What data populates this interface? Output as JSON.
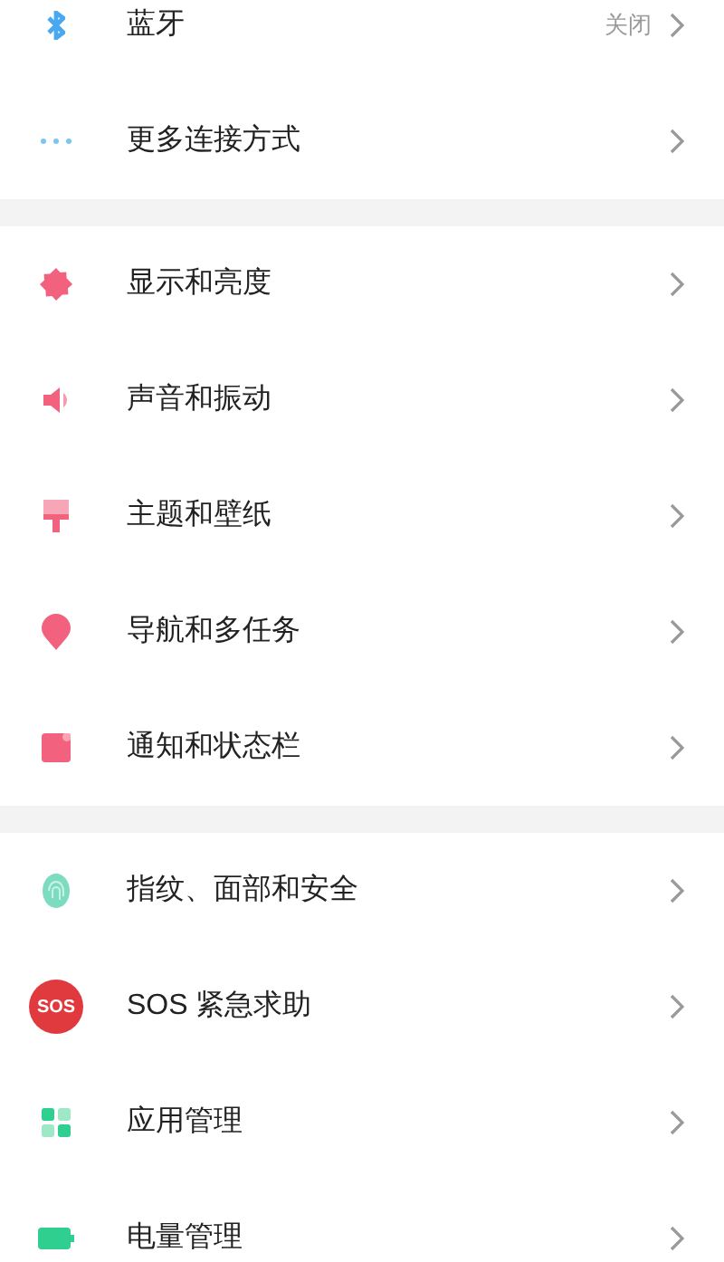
{
  "groups": [
    {
      "items": [
        {
          "kind": "bluetooth",
          "label": "蓝牙",
          "value": "关闭"
        },
        {
          "kind": "more",
          "label": "更多连接方式"
        }
      ]
    },
    {
      "items": [
        {
          "kind": "display",
          "label": "显示和亮度"
        },
        {
          "kind": "sound",
          "label": "声音和振动"
        },
        {
          "kind": "theme",
          "label": "主题和壁纸"
        },
        {
          "kind": "navigation",
          "label": "导航和多任务"
        },
        {
          "kind": "notification",
          "label": "通知和状态栏"
        }
      ]
    },
    {
      "items": [
        {
          "kind": "fingerprint",
          "label": "指纹、面部和安全"
        },
        {
          "kind": "sos",
          "label": "SOS 紧急求助",
          "badge": "SOS"
        },
        {
          "kind": "apps",
          "label": "应用管理"
        },
        {
          "kind": "battery",
          "label": "电量管理"
        }
      ]
    }
  ]
}
